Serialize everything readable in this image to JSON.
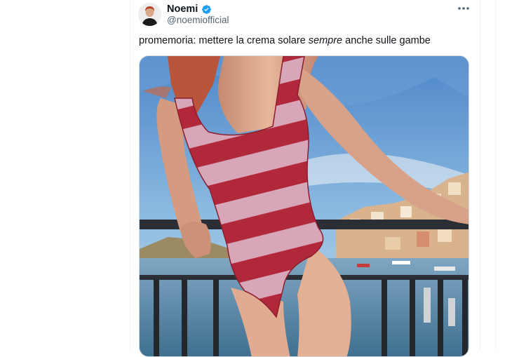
{
  "tweet": {
    "author": {
      "display_name": "Noemi",
      "handle": "@noemiofficial",
      "verified": true
    },
    "text_before": "promemoria: mettere la crema solare ",
    "text_emphasis": "sempre",
    "text_after": " anche sulle gambe",
    "more_icon": "more-horizontal-icon"
  },
  "colors": {
    "verified_blue": "#1d9bf0",
    "text_primary": "#0f1419",
    "text_secondary": "#536471"
  }
}
